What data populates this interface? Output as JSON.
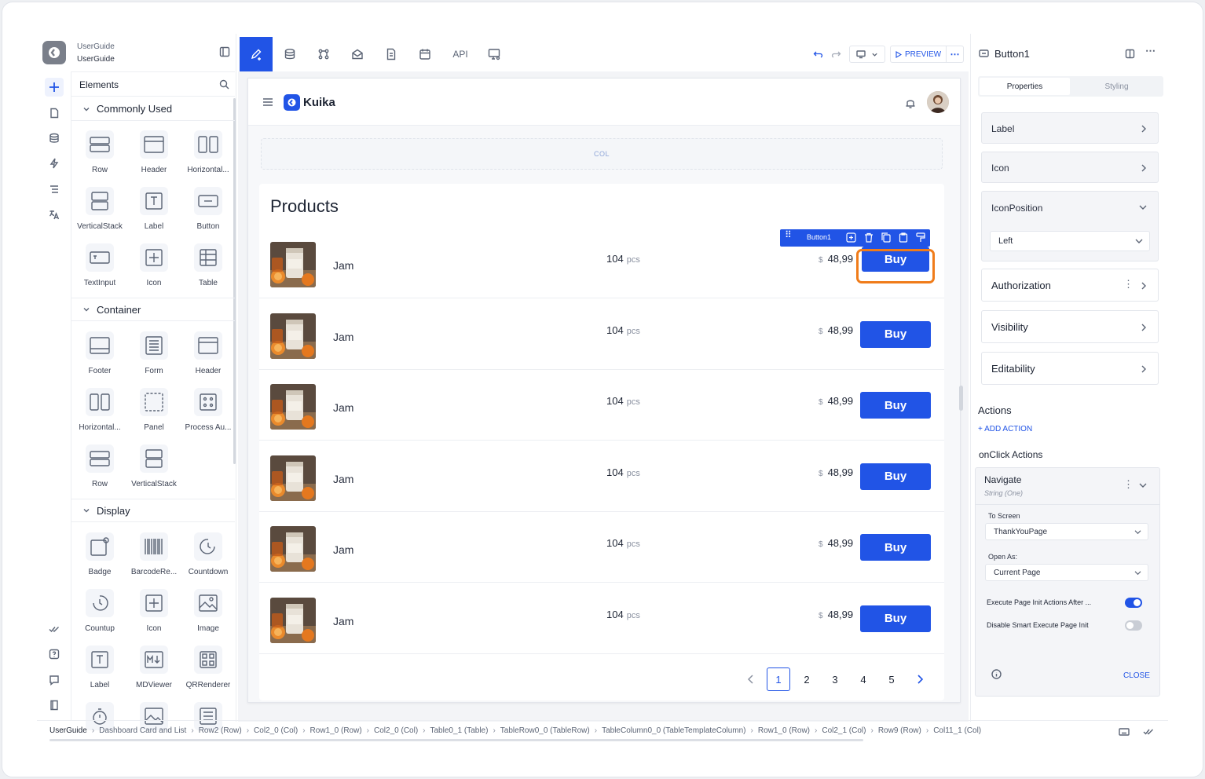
{
  "project": {
    "name": "UserGuide",
    "subname": "UserGuide"
  },
  "toolbar": {
    "api_label": "API",
    "preview_label": "PREVIEW"
  },
  "elements_panel": {
    "title": "Elements",
    "sections": [
      {
        "title": "Commonly Used",
        "items": [
          "Row",
          "Header",
          "Horizontal...",
          "VerticalStack",
          "Label",
          "Button",
          "TextInput",
          "Icon",
          "Table"
        ]
      },
      {
        "title": "Container",
        "items": [
          "Footer",
          "Form",
          "Header",
          "Horizontal...",
          "Panel",
          "Process Au...",
          "Row",
          "VerticalStack"
        ]
      },
      {
        "title": "Display",
        "items": [
          "Badge",
          "BarcodeRe...",
          "Countdown",
          "Countup",
          "Icon",
          "Image",
          "Label",
          "MDViewer",
          "QRRenderer"
        ]
      }
    ]
  },
  "preview": {
    "brand": "Kuika",
    "col_label": "COL",
    "title": "Products",
    "selected_label": "Button1",
    "products": [
      {
        "name": "Jam",
        "qty": "104",
        "unit": "pcs",
        "currency": "$",
        "price": "48,99",
        "button": "Buy"
      },
      {
        "name": "Jam",
        "qty": "104",
        "unit": "pcs",
        "currency": "$",
        "price": "48,99",
        "button": "Buy"
      },
      {
        "name": "Jam",
        "qty": "104",
        "unit": "pcs",
        "currency": "$",
        "price": "48,99",
        "button": "Buy"
      },
      {
        "name": "Jam",
        "qty": "104",
        "unit": "pcs",
        "currency": "$",
        "price": "48,99",
        "button": "Buy"
      },
      {
        "name": "Jam",
        "qty": "104",
        "unit": "pcs",
        "currency": "$",
        "price": "48,99",
        "button": "Buy"
      },
      {
        "name": "Jam",
        "qty": "104",
        "unit": "pcs",
        "currency": "$",
        "price": "48,99",
        "button": "Buy"
      }
    ],
    "pagination": {
      "pages": [
        "1",
        "2",
        "3",
        "4",
        "5"
      ],
      "current": "1"
    }
  },
  "props": {
    "component_name": "Button1",
    "tabs": [
      "Properties",
      "Styling"
    ],
    "active_tab": "Properties",
    "label": "Label",
    "icon": "Icon",
    "icon_position": "IconPosition",
    "icon_position_value": "Left",
    "authorization": "Authorization",
    "visibility": "Visibility",
    "editability": "Editability",
    "actions_title": "Actions",
    "add_action": "+ ADD ACTION",
    "onclick_title": "onClick Actions",
    "action": {
      "name": "Navigate",
      "type": "String (One)",
      "to_screen_label": "To Screen",
      "to_screen_value": "ThankYouPage",
      "open_as_label": "Open As:",
      "open_as_value": "Current Page",
      "execute_init_label": "Execute Page Init Actions After ...",
      "execute_init_on": true,
      "disable_smart_label": "Disable Smart Execute Page Init",
      "disable_smart_on": false,
      "close_label": "CLOSE"
    }
  },
  "breadcrumbs": [
    "UserGuide",
    "Dashboard Card and List",
    "Row2 (Row)",
    "Col2_0 (Col)",
    "Row1_0 (Row)",
    "Col2_0 (Col)",
    "Table0_1 (Table)",
    "TableRow0_0 (TableRow)",
    "TableColumn0_0 (TableTemplateColumn)",
    "Row1_0 (Row)",
    "Col2_1 (Col)",
    "Row9 (Row)",
    "Col11_1 (Col)"
  ],
  "colors": {
    "accent": "#2154e6",
    "highlight": "#f07c1a"
  }
}
